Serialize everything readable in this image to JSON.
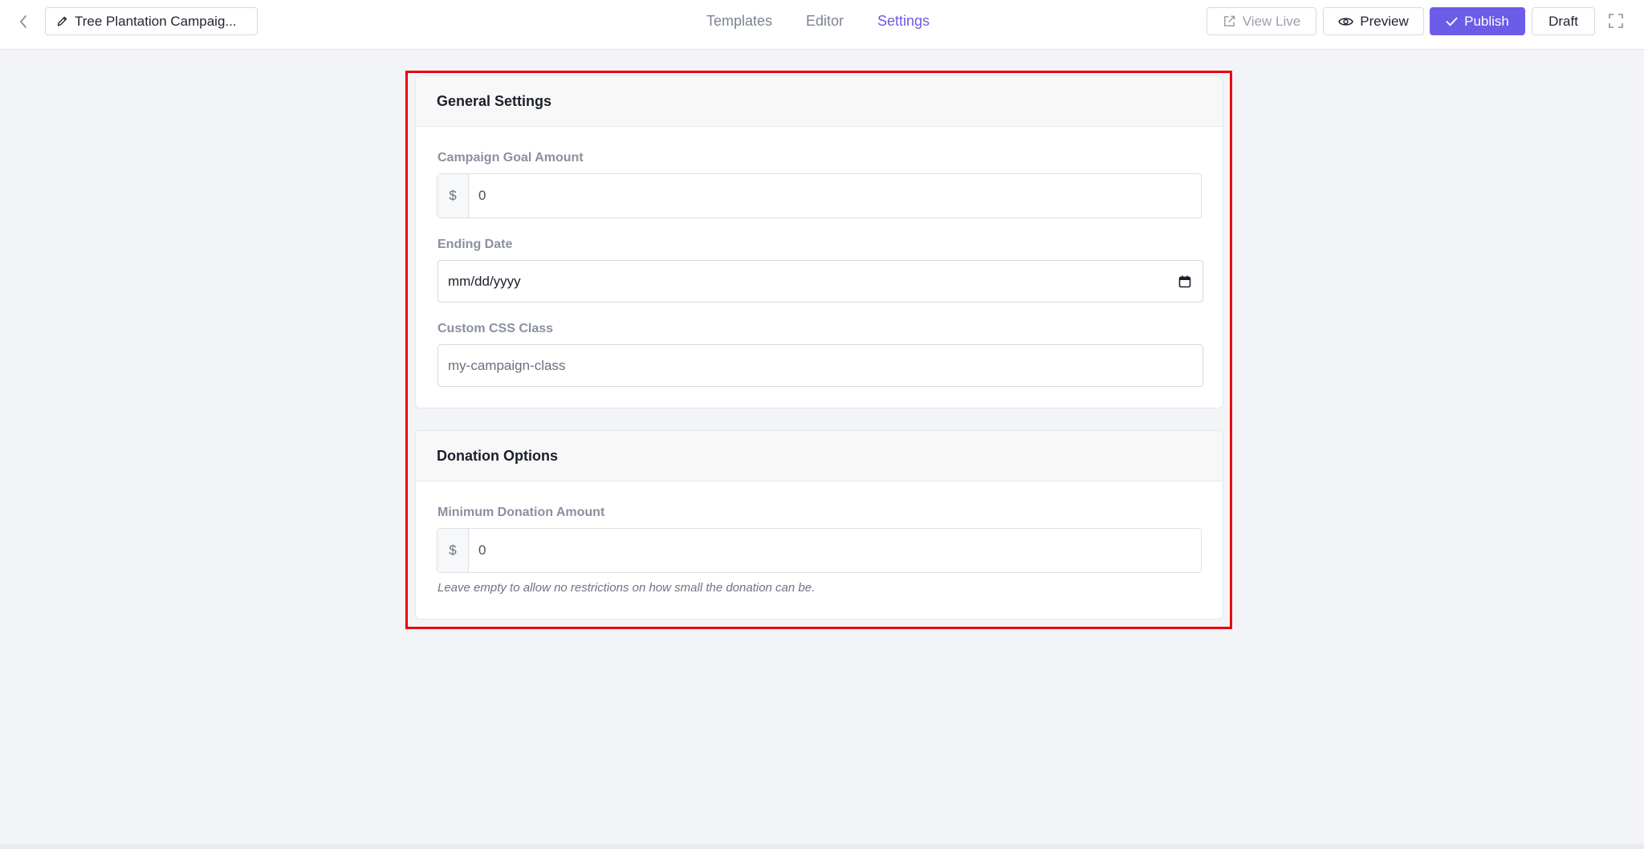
{
  "topbar": {
    "campaign_title": "Tree Plantation Campaig...",
    "tabs": [
      {
        "label": "Templates",
        "active": false
      },
      {
        "label": "Editor",
        "active": false
      },
      {
        "label": "Settings",
        "active": true
      }
    ],
    "buttons": {
      "view_live": "View Live",
      "preview": "Preview",
      "publish": "Publish",
      "draft": "Draft"
    }
  },
  "colors": {
    "accent": "#6c5ce7",
    "highlight_border": "#e8000b",
    "page_background": "#f3f4f7"
  },
  "general_settings": {
    "heading": "General Settings",
    "goal_amount": {
      "label": "Campaign Goal Amount",
      "currency": "$",
      "value": "0"
    },
    "ending_date": {
      "label": "Ending Date",
      "value": "mm/dd/yyyy"
    },
    "css_class": {
      "label": "Custom CSS Class",
      "placeholder": "my-campaign-class"
    }
  },
  "donation_options": {
    "heading": "Donation Options",
    "min_amount": {
      "label": "Minimum Donation Amount",
      "currency": "$",
      "value": "0",
      "help": "Leave empty to allow no restrictions on how small the donation can be."
    }
  }
}
